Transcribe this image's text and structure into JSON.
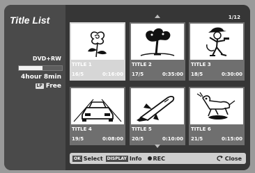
{
  "sidebar": {
    "title": "Title List",
    "disc_type": "DVD+RW",
    "usage_fraction": 0.55,
    "remaining": "4hour 8min",
    "mode_badge": "LP",
    "mode_label": "Free"
  },
  "page_indicator": "1/12",
  "titles": [
    {
      "name": "TITLE  1",
      "date": "16/5",
      "duration": "0:16:00",
      "thumb": "rose-icon"
    },
    {
      "name": "TITLE  2",
      "date": "17/5",
      "duration": "0:35:00",
      "thumb": "tree-icon"
    },
    {
      "name": "TITLE  3",
      "date": "18/5",
      "duration": "0:30:00",
      "thumb": "cowboy-icon"
    },
    {
      "name": "TITLE  4",
      "date": "19/5",
      "duration": "0:08:00",
      "thumb": "car-icon"
    },
    {
      "name": "TITLE  5",
      "date": "20/5",
      "duration": "0:10:00",
      "thumb": "space-shuttle-icon"
    },
    {
      "name": "TITLE  6",
      "date": "21/5",
      "duration": "0:15:00",
      "thumb": "dog-icon"
    }
  ],
  "footer": {
    "ok_badge": "OK",
    "select_label": "Select",
    "display_badge": "DISPLAY",
    "info_label": "Info",
    "rec_label": "REC",
    "close_label": "Close"
  }
}
